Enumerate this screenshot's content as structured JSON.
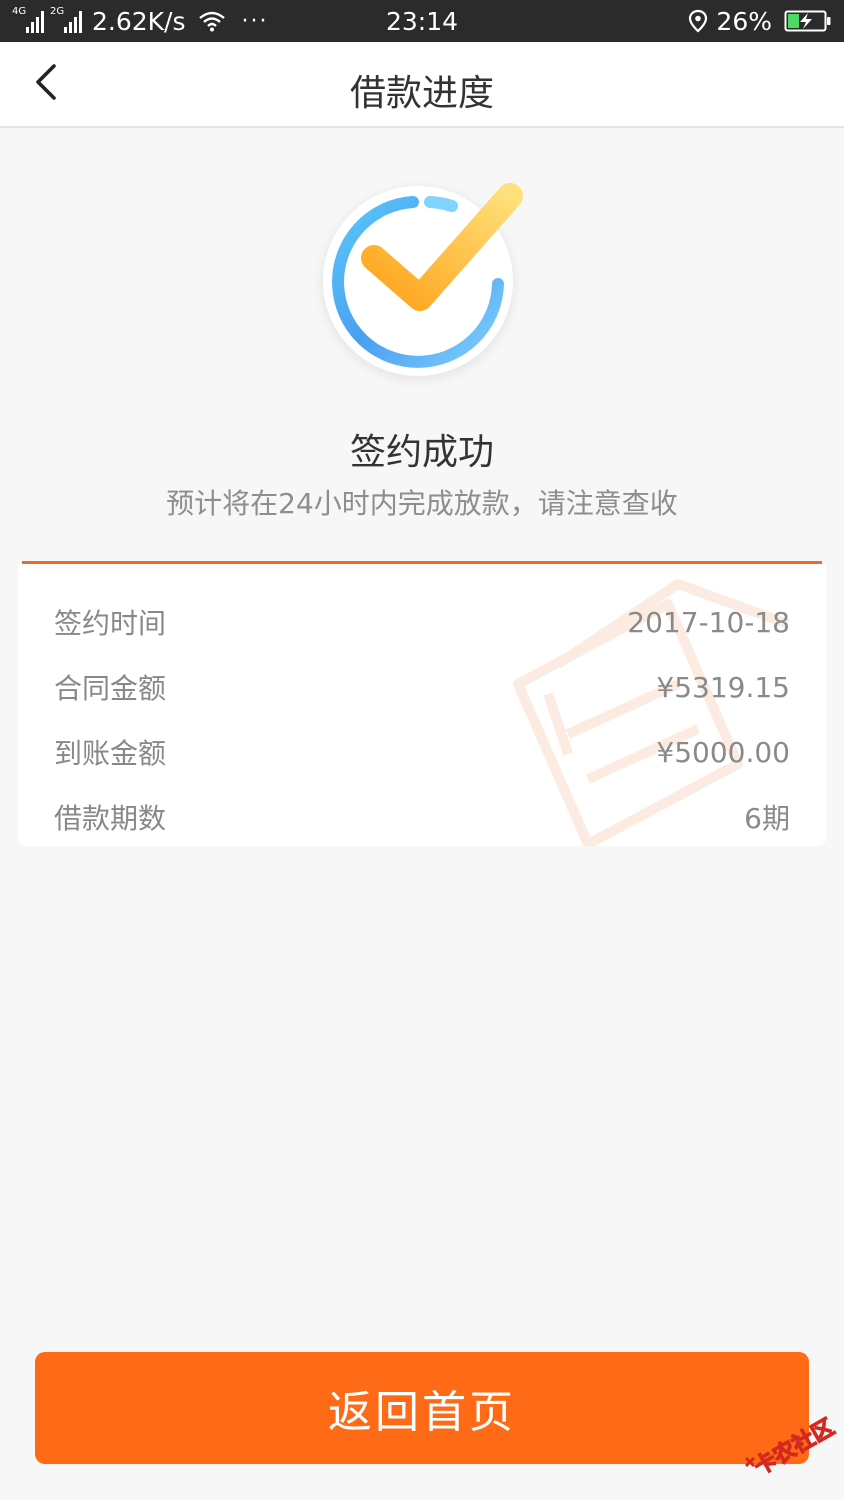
{
  "status_bar": {
    "net1": "4G",
    "net2": "2G",
    "speed": "2.62K/s",
    "dots": "···",
    "time": "23:14",
    "battery": "26%"
  },
  "header": {
    "title": "借款进度"
  },
  "success": {
    "title": "签约成功",
    "subtitle": "预计将在24小时内完成放款，请注意查收"
  },
  "details": [
    {
      "label": "签约时间",
      "value": "2017-10-18"
    },
    {
      "label": "合同金额",
      "value": "¥5319.15"
    },
    {
      "label": "到账金额",
      "value": "¥5000.00"
    },
    {
      "label": "借款期数",
      "value": "6期"
    }
  ],
  "footer": {
    "button_label": "返回首页"
  },
  "watermark": {
    "text": "卡农社区"
  },
  "colors": {
    "accent": "#ff6a16",
    "status_bar_bg": "#2b2b2b",
    "page_bg": "#f7f7f7",
    "check_orange": "#ffa726",
    "ring_blue": "#4aa3f0"
  }
}
